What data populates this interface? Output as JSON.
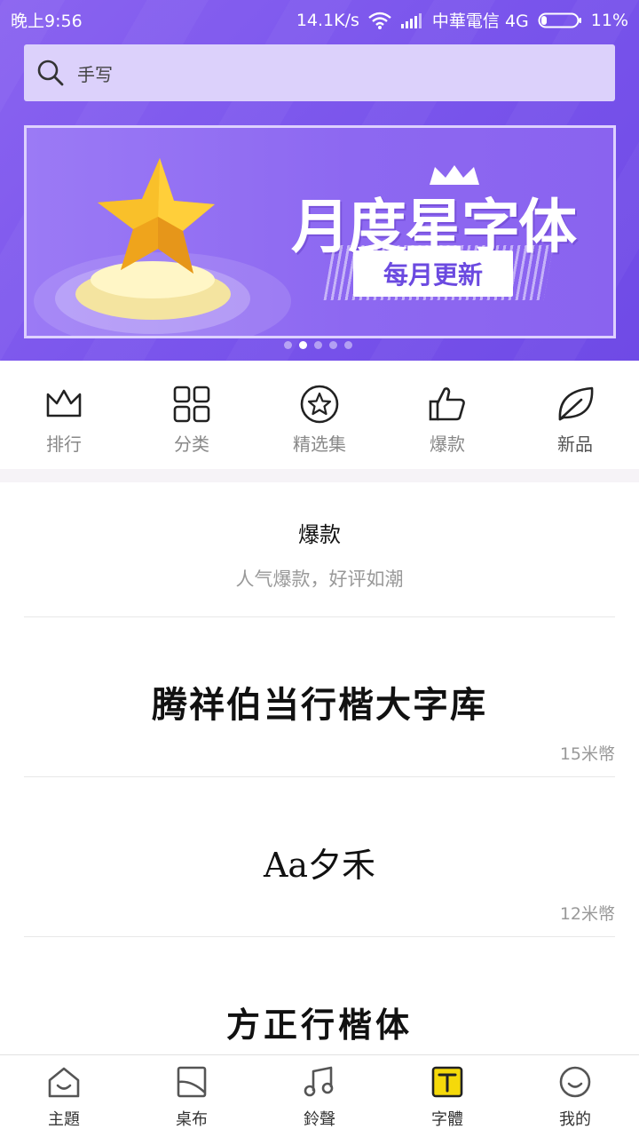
{
  "status_bar": {
    "time": "晚上9:56",
    "speed": "14.1K/s",
    "carrier": "中華電信 4G",
    "battery": "11%"
  },
  "search": {
    "placeholder": "手写",
    "icon": "search-icon"
  },
  "banner": {
    "title": "月度星字体",
    "subtitle": "每月更新",
    "page_count": 5,
    "active_page": 2
  },
  "categories": [
    {
      "label": "排行",
      "icon": "crown-icon"
    },
    {
      "label": "分类",
      "icon": "grid-icon"
    },
    {
      "label": "精选集",
      "icon": "star-circle-icon"
    },
    {
      "label": "爆款",
      "icon": "thumbs-up-icon"
    },
    {
      "label": "新品",
      "icon": "leaf-icon"
    }
  ],
  "section": {
    "title": "爆款",
    "subtitle": "人气爆款，好评如潮"
  },
  "fonts": [
    {
      "name": "腾祥伯当行楷大字库",
      "price": "15米幣"
    },
    {
      "name": "Aa夕禾",
      "price": "12米幣"
    },
    {
      "name": "方正行楷体",
      "price": ""
    }
  ],
  "tabs": [
    {
      "label": "主題",
      "icon": "home-icon"
    },
    {
      "label": "桌布",
      "icon": "wallpaper-icon"
    },
    {
      "label": "鈴聲",
      "icon": "music-note-icon"
    },
    {
      "label": "字體",
      "icon": "font-icon",
      "active": true
    },
    {
      "label": "我的",
      "icon": "smile-icon"
    }
  ],
  "colors": {
    "header_purple": "#7a55ec",
    "search_bg": "#dcd1fb",
    "active_tab_yellow": "#f5d90a"
  }
}
